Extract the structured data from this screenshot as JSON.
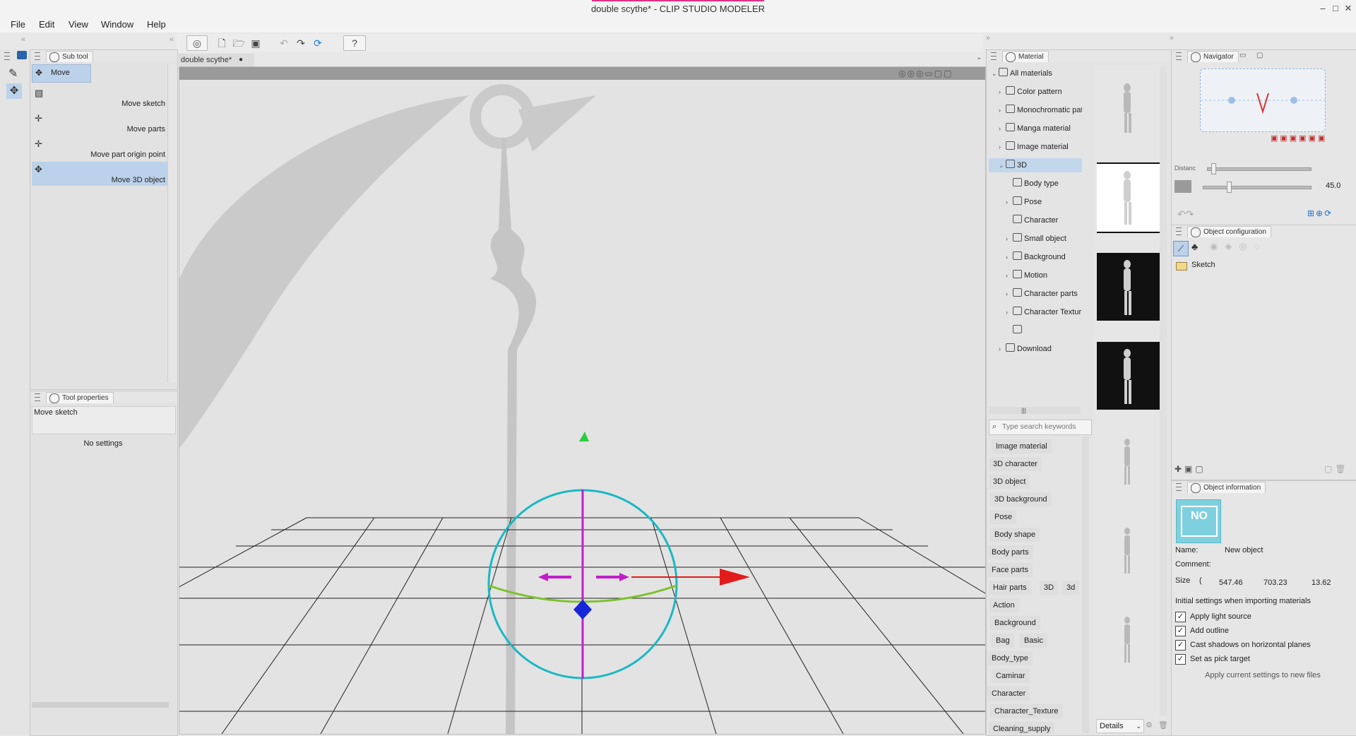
{
  "window": {
    "title": "double scythe* - CLIP STUDIO MODELER"
  },
  "menu": [
    "File",
    "Edit",
    "View",
    "Window",
    "Help"
  ],
  "subtool": {
    "tab": "Sub tool",
    "active_group": "Move",
    "items": [
      "Move sketch",
      "Move parts",
      "Move part origin point",
      "Move 3D object"
    ]
  },
  "tool_properties": {
    "tab": "Tool properties",
    "name": "Move sketch",
    "empty_text": "No settings"
  },
  "document": {
    "tab": "double scythe*"
  },
  "material": {
    "tab": "Material",
    "tree": [
      {
        "label": "All materials",
        "arrow": "⌄"
      },
      {
        "label": "Color pattern",
        "arrow": "›"
      },
      {
        "label": "Monochromatic pat",
        "arrow": "›"
      },
      {
        "label": "Manga material",
        "arrow": "›"
      },
      {
        "label": "Image material",
        "arrow": "›"
      },
      {
        "label": "3D",
        "arrow": "⌄"
      },
      {
        "label": "Body type",
        "arrow": ""
      },
      {
        "label": "Pose",
        "arrow": "›"
      },
      {
        "label": "Character",
        "arrow": ""
      },
      {
        "label": "Small object",
        "arrow": "›"
      },
      {
        "label": "Background",
        "arrow": "›"
      },
      {
        "label": "Motion",
        "arrow": "›"
      },
      {
        "label": "Character parts",
        "arrow": "›"
      },
      {
        "label": "Character Textur",
        "arrow": "›"
      },
      {
        "label": "Download",
        "arrow": "›"
      }
    ],
    "search_placeholder": "Type search keywords",
    "tags": [
      [
        "Image material"
      ],
      [
        "3D character"
      ],
      [
        "3D object"
      ],
      [
        "3D background"
      ],
      [
        "Pose"
      ],
      [
        "Body shape"
      ],
      [
        "Body parts"
      ],
      [
        "Face parts"
      ],
      [
        "Hair parts",
        "3D",
        "3d"
      ],
      [
        "Action"
      ],
      [
        "Background"
      ],
      [
        "Bag",
        "Basic"
      ],
      [
        "Body_type"
      ],
      [
        "Caminar"
      ],
      [
        "Character"
      ],
      [
        "Character_Texture"
      ],
      [
        "Cleaning_supply"
      ]
    ],
    "view_select": "Details"
  },
  "navigator": {
    "tab": "Navigator",
    "distance_label": "Distanc",
    "angle_value": "45.0"
  },
  "object_configuration": {
    "tab": "Object configuration",
    "root": "Sketch"
  },
  "object_information": {
    "tab": "Object information",
    "no_image": "NO",
    "name_label": "Name:",
    "name_value": "New object",
    "comment_label": "Comment:",
    "size_label": "Size",
    "size_values": [
      "547.46",
      "703.23",
      "13.62"
    ],
    "import_heading": "Initial settings when importing materials",
    "options": [
      {
        "label": "Apply light source",
        "checked": true
      },
      {
        "label": "Add outline",
        "checked": true
      },
      {
        "label": "Cast shadows on horizontal planes",
        "checked": true
      },
      {
        "label": "Set as pick target",
        "checked": true
      }
    ],
    "apply_button": "Apply current settings to new files"
  },
  "colors": {
    "selection": "#bcd2ea",
    "canvas": "#e3e3e3",
    "gizmo_ring": "#1ab8c4",
    "axis_x": "#e31b1b",
    "axis_y": "#c01fc8",
    "axis_z": "#1626d9"
  }
}
